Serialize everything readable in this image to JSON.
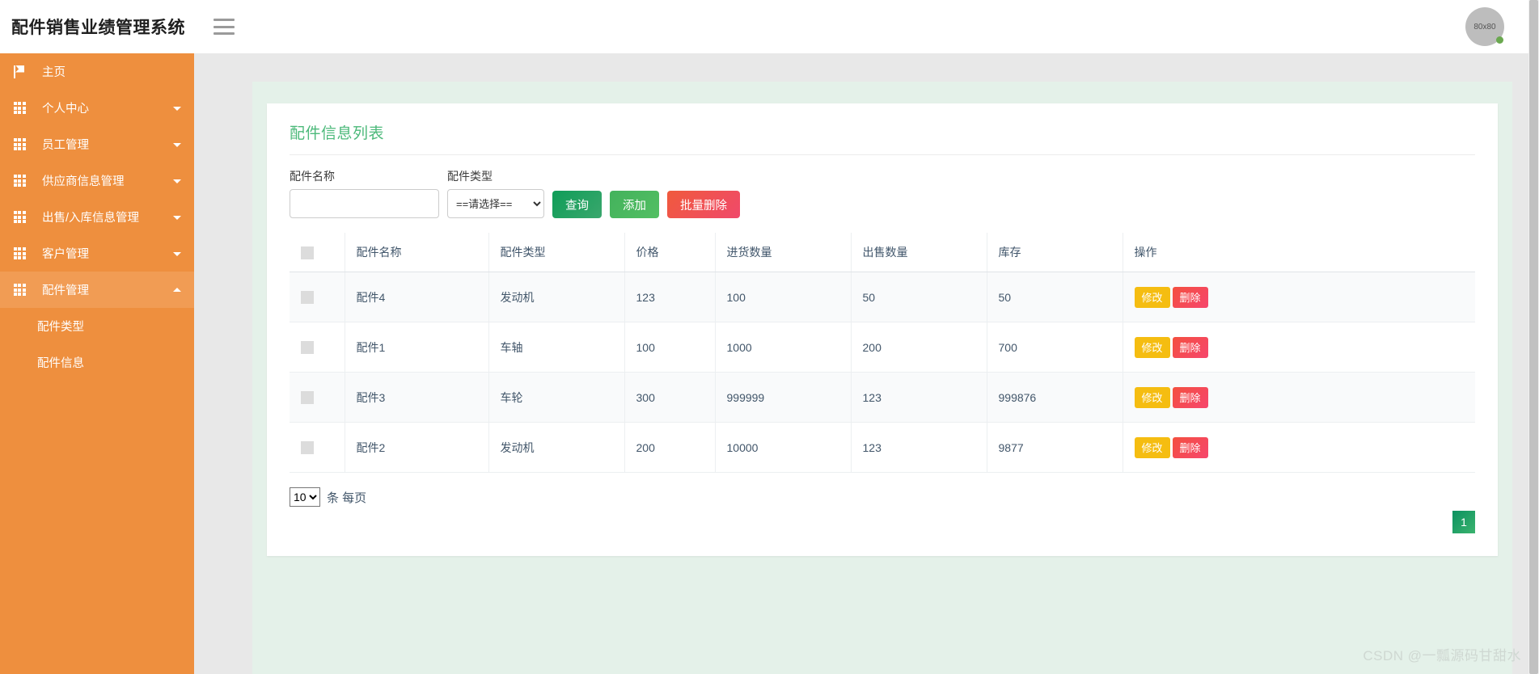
{
  "header": {
    "title": "配件销售业绩管理系统",
    "menu_icon": "hamburger-icon",
    "avatar_text": "80x80"
  },
  "sidebar": {
    "items": [
      {
        "label": "主页",
        "icon": "flag-icon",
        "has_caret": false,
        "active": false
      },
      {
        "label": "个人中心",
        "icon": "grid-icon",
        "has_caret": true,
        "active": false
      },
      {
        "label": "员工管理",
        "icon": "grid-icon",
        "has_caret": true,
        "active": false
      },
      {
        "label": "供应商信息管理",
        "icon": "grid-icon",
        "has_caret": true,
        "active": false
      },
      {
        "label": "出售/入库信息管理",
        "icon": "grid-icon",
        "has_caret": true,
        "active": false
      },
      {
        "label": "客户管理",
        "icon": "grid-icon",
        "has_caret": true,
        "active": false
      },
      {
        "label": "配件管理",
        "icon": "grid-icon",
        "has_caret": true,
        "active": true
      }
    ],
    "submenu": [
      {
        "label": "配件类型"
      },
      {
        "label": "配件信息"
      }
    ]
  },
  "card": {
    "title": "配件信息列表",
    "filters": {
      "name_label": "配件名称",
      "name_value": "",
      "name_placeholder": "",
      "type_label": "配件类型",
      "type_selected": "==请选择==",
      "type_options": [
        "==请选择=="
      ],
      "query_label": "查询",
      "add_label": "添加",
      "batch_delete_label": "批量删除"
    },
    "table": {
      "headers": [
        "",
        "配件名称",
        "配件类型",
        "价格",
        "进货数量",
        "出售数量",
        "库存",
        "操作"
      ],
      "rows": [
        {
          "name": "配件4",
          "type": "发动机",
          "price": "123",
          "purchased": "100",
          "sold": "50",
          "stock": "50"
        },
        {
          "name": "配件1",
          "type": "车轴",
          "price": "100",
          "purchased": "1000",
          "sold": "200",
          "stock": "700"
        },
        {
          "name": "配件3",
          "type": "车轮",
          "price": "300",
          "purchased": "999999",
          "sold": "123",
          "stock": "999876"
        },
        {
          "name": "配件2",
          "type": "发动机",
          "price": "200",
          "purchased": "10000",
          "sold": "123",
          "stock": "9877"
        }
      ],
      "edit_label": "修改",
      "delete_label": "删除"
    },
    "footer": {
      "page_size_selected": "10",
      "page_size_options": [
        "10"
      ],
      "per_page_text": "条 每页",
      "current_page": "1"
    }
  },
  "watermark": "CSDN @一瓢源码甘甜水",
  "colors": {
    "sidebar": "#ee8f3e",
    "sidebar_active": "#f19c54",
    "title_green": "#4cb97a",
    "btn_query": "#0f9d58",
    "btn_add": "#43b25c",
    "btn_delete": "#f0496b",
    "btn_edit": "#f5bd11",
    "panel_mint": "#e4f1e9"
  }
}
